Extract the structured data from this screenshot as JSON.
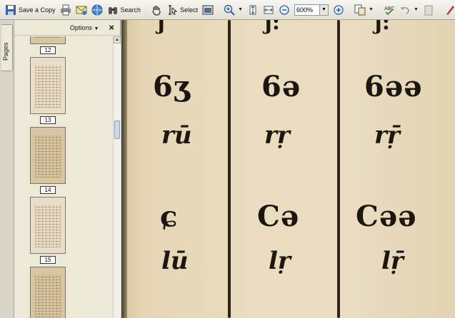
{
  "toolbar": {
    "save_copy_label": "Save a Copy",
    "search_label": "Search",
    "select_label": "Select",
    "zoom_value": "600%"
  },
  "sidebar": {
    "tab_label": "Pages",
    "options_label": "Options",
    "close_label": "×",
    "thumbnails": [
      {
        "page": "12"
      },
      {
        "page": "13"
      },
      {
        "page": "14"
      },
      {
        "page": "15"
      }
    ]
  },
  "document": {
    "columns": [
      {
        "top": "ȷ",
        "row1_script": "6ʒ",
        "row1_translit": "rū",
        "row2_script": "ɕ",
        "row2_translit": "lū"
      },
      {
        "top": "ȷ:",
        "row1_script": "6ə",
        "row1_translit": "rṛ",
        "row2_script": "Cə",
        "row2_translit": "lṛ"
      },
      {
        "top": "ȷ:",
        "row1_script": "6əə",
        "row1_translit": "rṝ",
        "row2_script": "Cəə",
        "row2_translit": "lṝ"
      }
    ]
  }
}
